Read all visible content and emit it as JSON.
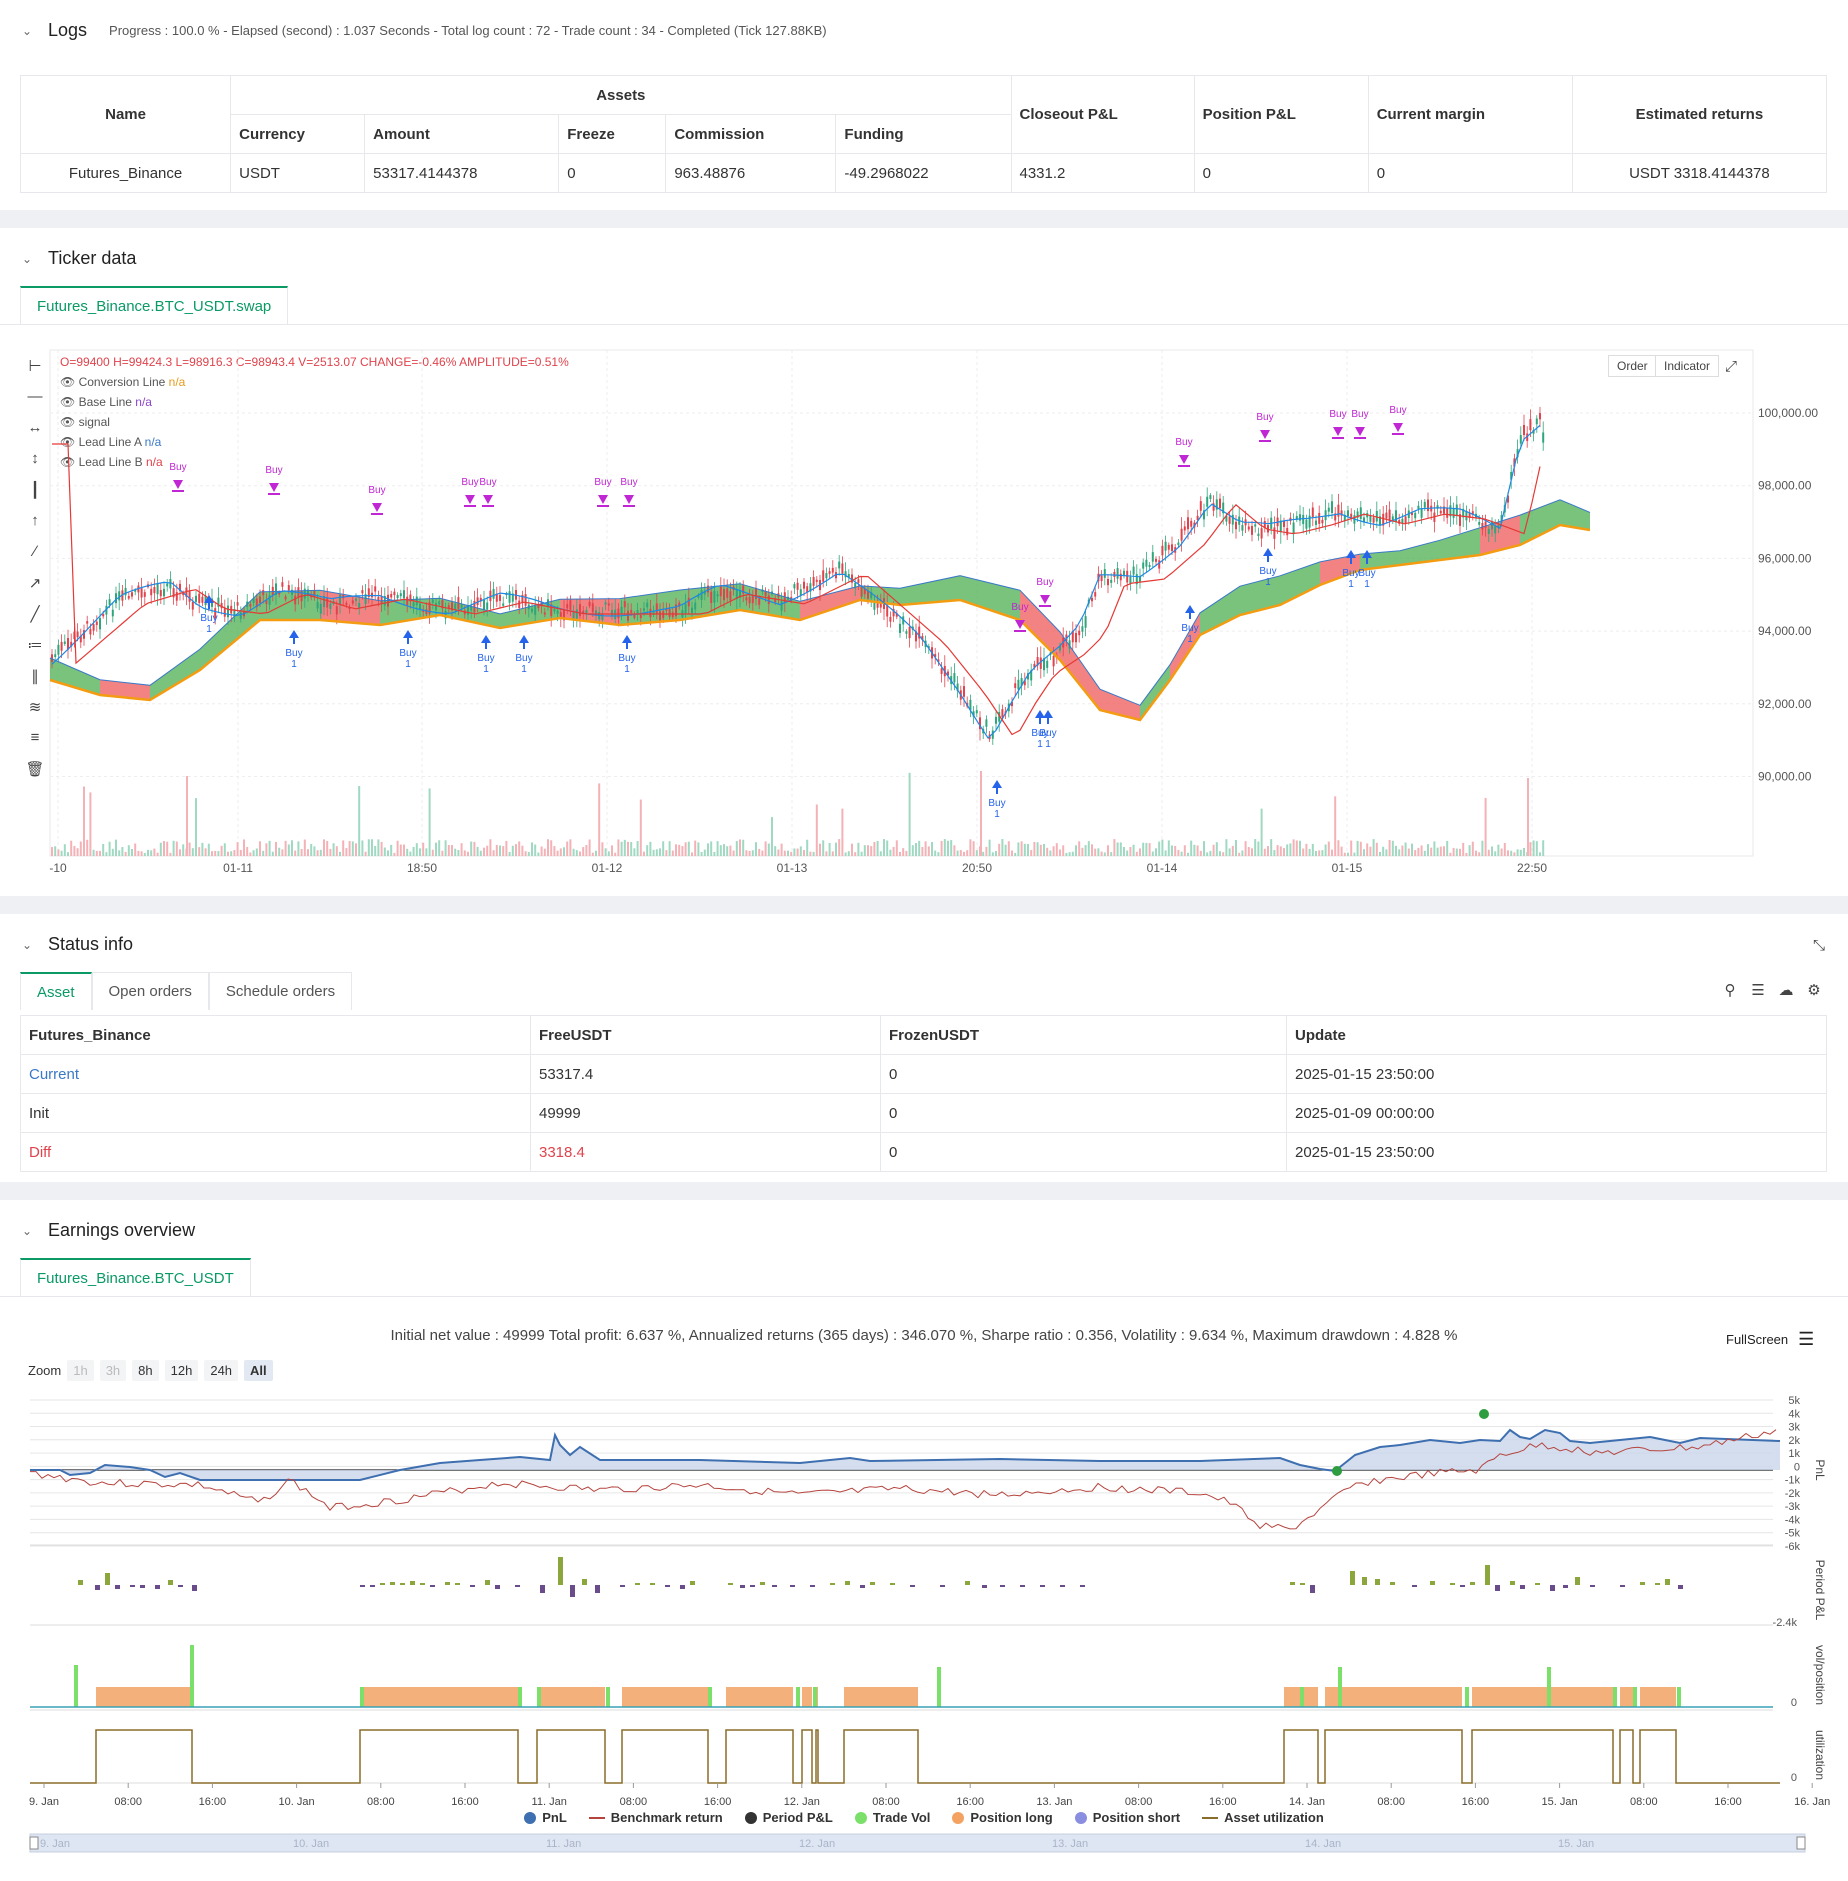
{
  "logs": {
    "title": "Logs",
    "meta": "Progress : 100.0 % - Elapsed (second) : 1.037  Seconds - Total log count : 72 - Trade count : 34 - Completed (Tick 127.88KB)",
    "headers": {
      "name": "Name",
      "assets": "Assets",
      "currency": "Currency",
      "amount": "Amount",
      "freeze": "Freeze",
      "commission": "Commission",
      "funding": "Funding",
      "closeout": "Closeout P&L",
      "position": "Position P&L",
      "margin": "Current margin",
      "returns": "Estimated returns"
    },
    "row": {
      "name": "Futures_Binance",
      "currency": "USDT",
      "amount": "53317.4144378",
      "freeze": "0",
      "commission": "963.48876",
      "funding": "-49.2968022",
      "closeout": "4331.2",
      "position": "0",
      "margin": "0",
      "returns": "USDT 3318.4144378"
    }
  },
  "ticker": {
    "title": "Ticker data",
    "tab": "Futures_Binance.BTC_USDT.swap",
    "ohlc": {
      "o": "O=99400",
      "h": "H=99424.3",
      "l": "L=98916.3",
      "c": "C=98943.4",
      "v": "V=2513.07",
      "change": "CHANGE=-0.46%",
      "amp": "AMPLITUDE=0.51%"
    },
    "legend": [
      {
        "label": "Conversion Line",
        "value": "n/a"
      },
      {
        "label": "Base Line",
        "value": "n/a"
      },
      {
        "label": "signal",
        "value": ""
      },
      {
        "label": "Lead Line A",
        "value": "n/a"
      },
      {
        "label": "Lead Line B",
        "value": "n/a"
      }
    ],
    "buttons": {
      "order": "Order",
      "indicator": "Indicator"
    },
    "y_ticks": [
      "100,000.00",
      "98,000.00",
      "96,000.00",
      "94,000.00",
      "92,000.00",
      "90,000.00"
    ],
    "x_ticks": [
      "-10",
      "01-11",
      "18:50",
      "01-12",
      "01-13",
      "20:50",
      "01-14",
      "01-15",
      "22:50"
    ],
    "marker_buy": "Buy",
    "marker_one": "1"
  },
  "status": {
    "title": "Status info",
    "tabs": [
      "Asset",
      "Open orders",
      "Schedule orders"
    ],
    "headers": [
      "Futures_Binance",
      "FreeUSDT",
      "FrozenUSDT",
      "Update"
    ],
    "rows": [
      {
        "name": "Current",
        "free": "53317.4",
        "frozen": "0",
        "update": "2025-01-15 23:50:00"
      },
      {
        "name": "Init",
        "free": "49999",
        "frozen": "0",
        "update": "2025-01-09 00:00:00"
      },
      {
        "name": "Diff",
        "free": "3318.4",
        "frozen": "0",
        "update": "2025-01-15 23:50:00"
      }
    ]
  },
  "earnings": {
    "title": "Earnings overview",
    "tab": "Futures_Binance.BTC_USDT",
    "summary": "Initial net value : 49999 Total profit: 6.637 %, Annualized returns (365 days) : 346.070 %, Sharpe ratio : 0.356, Volatility : 9.634 %, Maximum drawdown : 4.828 %",
    "fullscreen": "FullScreen",
    "zoom_label": "Zoom",
    "zoom": [
      "1h",
      "3h",
      "8h",
      "12h",
      "24h",
      "All"
    ],
    "pnl_ticks": [
      "5k",
      "4k",
      "3k",
      "2k",
      "1k",
      "0",
      "-1k",
      "-2k",
      "-3k",
      "-4k",
      "-5k",
      "-6k"
    ],
    "axis_labels": {
      "pnl": "PnL",
      "period": "Period P&L",
      "vol": "vol/position",
      "util": "utilization"
    },
    "period_tick": "-2.4k",
    "zero": "0",
    "x_ticks": [
      "9. Jan",
      "08:00",
      "16:00",
      "10. Jan",
      "08:00",
      "16:00",
      "11. Jan",
      "08:00",
      "16:00",
      "12. Jan",
      "08:00",
      "16:00",
      "13. Jan",
      "08:00",
      "16:00",
      "14. Jan",
      "08:00",
      "16:00",
      "15. Jan",
      "08:00",
      "16:00",
      "16. Jan"
    ],
    "navigator": [
      "9. Jan",
      "10. Jan",
      "11. Jan",
      "12. Jan",
      "13. Jan",
      "14. Jan",
      "15. Jan"
    ],
    "legend": [
      {
        "name": "PnL",
        "color": "#3e6fb0",
        "shape": "dot"
      },
      {
        "name": "Benchmark return",
        "color": "#b5443e",
        "shape": "line"
      },
      {
        "name": "Period P&L",
        "color": "#333333",
        "shape": "dot"
      },
      {
        "name": "Trade Vol",
        "color": "#7be06a",
        "shape": "dot"
      },
      {
        "name": "Position long",
        "color": "#f4a261",
        "shape": "dot"
      },
      {
        "name": "Position short",
        "color": "#8a8ee0",
        "shape": "dot"
      },
      {
        "name": "Asset utilization",
        "color": "#8a6d2a",
        "shape": "line"
      }
    ]
  }
}
